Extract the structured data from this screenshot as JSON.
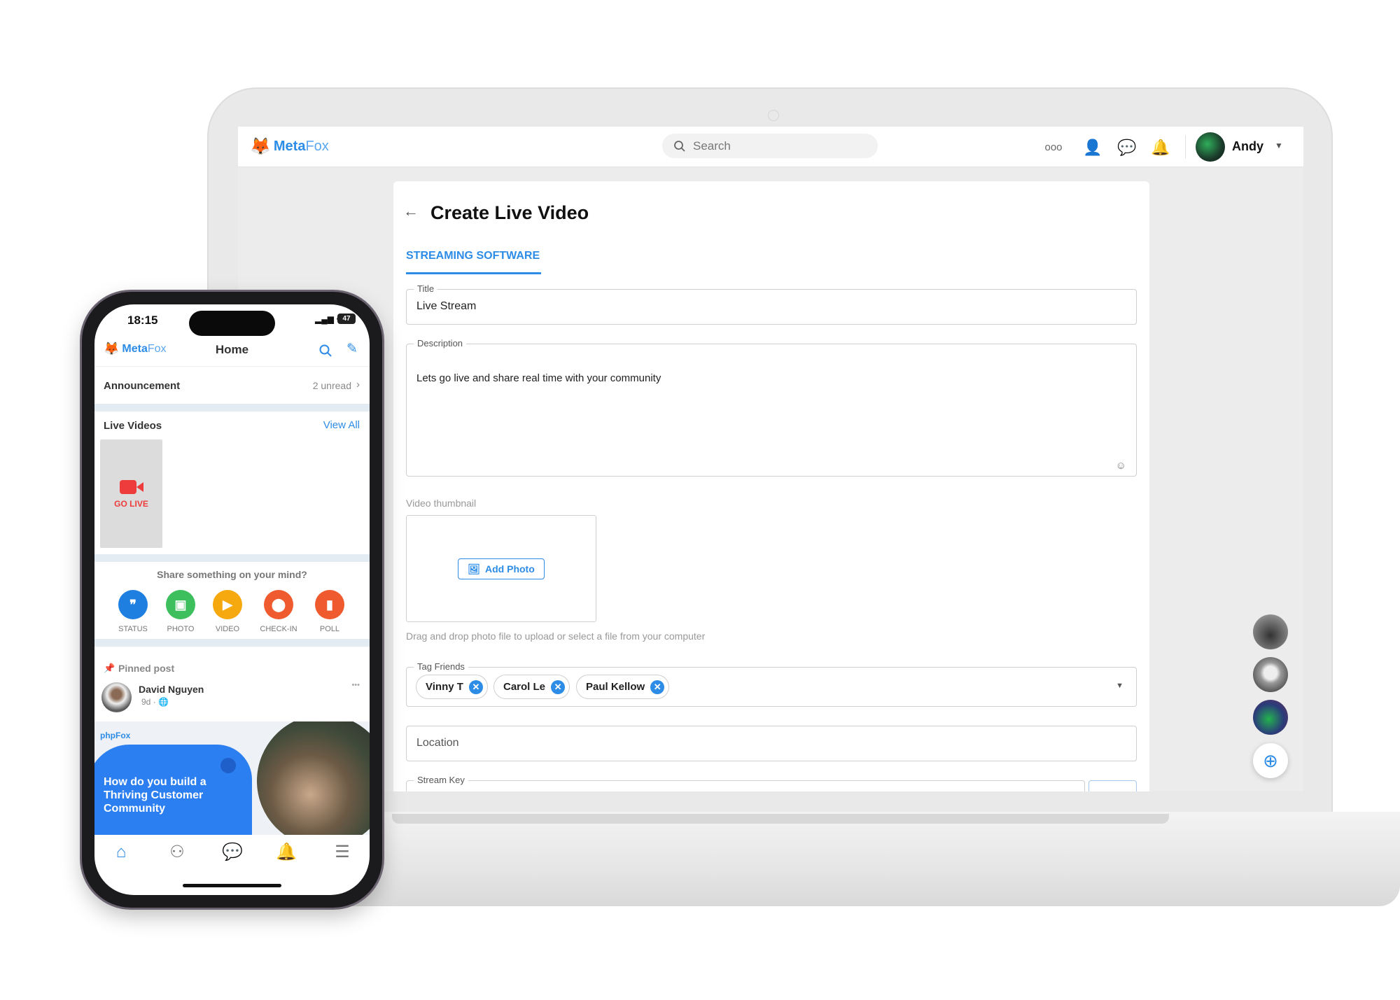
{
  "desktop": {
    "logo": {
      "bold": "Meta",
      "light": "Fox"
    },
    "search_placeholder": "Search",
    "header_icons": [
      "more-icon",
      "add-friend-icon",
      "messages-icon",
      "notifications-icon"
    ],
    "user_name": "Andy",
    "page_title": "Create Live Video",
    "tab": "STREAMING SOFTWARE",
    "form": {
      "title_label": "Title",
      "title_value": "Live Stream",
      "description_label": "Description",
      "description_value": "Lets go live and share real time with your community",
      "thumbnail_label": "Video thumbnail",
      "add_photo": "Add Photo",
      "thumbnail_help": "Drag and drop photo file to upload or select a file from your computer",
      "tag_friends_label": "Tag Friends",
      "tagged": [
        "Vinny T",
        "Carol Le",
        "Paul Kellow"
      ],
      "location_placeholder": "Location",
      "stream_key_label": "Stream Key"
    },
    "accent": "#2d8ce6"
  },
  "mobile": {
    "time": "18:15",
    "battery": "47",
    "logo": {
      "bold": "Meta",
      "light": "Fox"
    },
    "title": "Home",
    "announcement": "Announcement",
    "unread": "2 unread",
    "live_videos": "Live Videos",
    "view_all": "View All",
    "go_live": "GO LIVE",
    "share_prompt": "Share something on your mind?",
    "share_actions": [
      {
        "label": "STATUS",
        "color": "#1f7fe0"
      },
      {
        "label": "PHOTO",
        "color": "#3cbf5c"
      },
      {
        "label": "VIDEO",
        "color": "#f5a90f"
      },
      {
        "label": "CHECK-IN",
        "color": "#ef5a2e"
      },
      {
        "label": "POLL",
        "color": "#ef5a2e"
      }
    ],
    "pinned": "Pinned post",
    "author": "David Nguyen",
    "age": "9d",
    "banner": {
      "brand": "phpFox",
      "headline": "How do you build a Thriving Customer Community"
    },
    "nav": [
      "home-icon",
      "friends-icon",
      "chat-icon",
      "bell-icon",
      "menu-icon"
    ]
  }
}
